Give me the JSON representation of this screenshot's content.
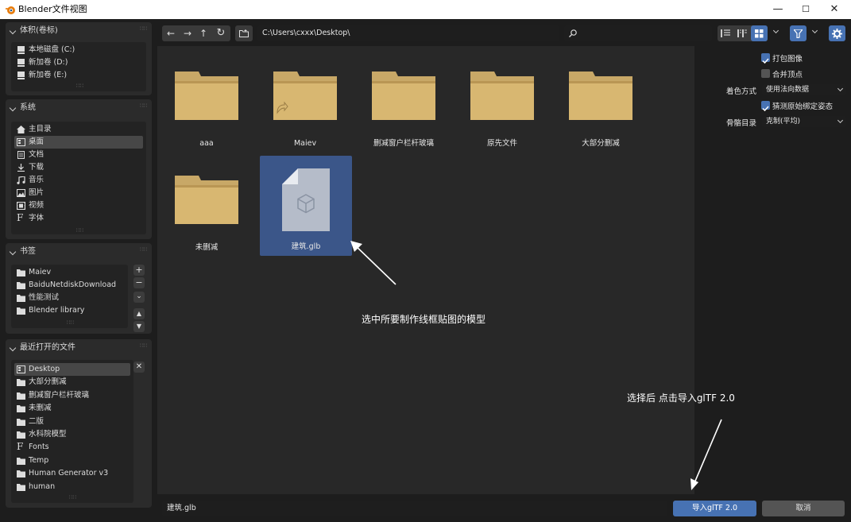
{
  "window": {
    "title": "Blender文件视图",
    "minimize": "—",
    "maximize": "☐",
    "close": "✕"
  },
  "panels": {
    "volumes": {
      "title": "体积(卷标)",
      "items": [
        "本地磁盘 (C:)",
        "新加卷 (D:)",
        "新加卷 (E:)"
      ]
    },
    "system": {
      "title": "系统",
      "items": [
        "主目录",
        "桌面",
        "文档",
        "下载",
        "音乐",
        "图片",
        "视频",
        "字体"
      ]
    },
    "bookmarks": {
      "title": "书签",
      "items": [
        "Maiev",
        "BaiduNetdiskDownload",
        "性能测试",
        "Blender library"
      ]
    },
    "recent": {
      "title": "最近打开的文件",
      "items": [
        "Desktop",
        "大部分删减",
        "删减窗户栏杆玻璃",
        "未删减",
        "二版",
        "水科院模型",
        "Fonts",
        "Temp",
        "Human Generator v3",
        "human"
      ]
    }
  },
  "toolbar": {
    "path": "C:\\Users\\cxxx\\Desktop\\",
    "search_placeholder": ""
  },
  "files": [
    "aaa",
    "Maiev",
    "删减窗户栏杆玻璃",
    "原先文件",
    "大部分删减",
    "未删减",
    "建筑.glb"
  ],
  "options": {
    "pack_images": "打包图像",
    "merge_vertices": "合并顶点",
    "shading_label": "着色方式",
    "shading_value": "使用法向数据",
    "guess_bind_pose": "猜测原始绑定姿态",
    "bone_dir_label": "骨骼目录",
    "bone_dir_value": "克制(平均)"
  },
  "bottom": {
    "filename": "建筑.glb",
    "import_label": "导入glTF 2.0",
    "cancel_label": "取消"
  },
  "annotations": {
    "select_model": "选中所要制作线框贴图的模型",
    "click_import": "选择后 点击导入glTF 2.0"
  },
  "colors": {
    "accent": "#4772b3",
    "folder": "#c8a867",
    "selected_cell": "#3b5689"
  }
}
